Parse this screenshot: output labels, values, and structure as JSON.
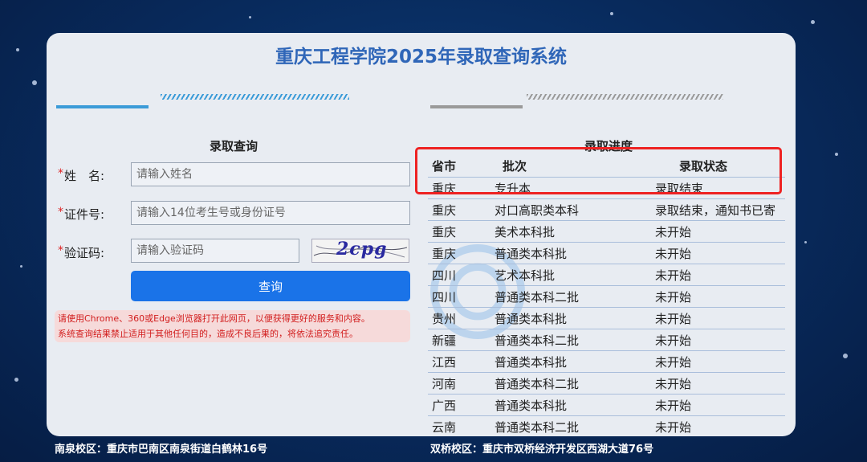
{
  "header": {
    "title": "重庆工程学院2025年录取查询系统"
  },
  "query_form": {
    "section_title": "录取查询",
    "name": {
      "label": "姓　名:",
      "placeholder": "请输入姓名"
    },
    "id_number": {
      "label": "证件号:",
      "placeholder": "请输入14位考生号或身份证号"
    },
    "captcha": {
      "label": "验证码:",
      "placeholder": "请输入验证码",
      "image_text": "2cpg"
    },
    "required_mark": "*",
    "submit_label": "查询",
    "notice_line1": "请使用Chrome、360或Edge浏览器打开此网页，以便获得更好的服务和内容。",
    "notice_line2": "系统查询结果禁止适用于其他任何目的，造成不良后果的，将依法追究责任。"
  },
  "progress": {
    "section_title": "录取进度",
    "columns": [
      "省市",
      "批次",
      "录取状态"
    ],
    "rows": [
      [
        "重庆",
        "专升本",
        "录取结束"
      ],
      [
        "重庆",
        "对口高职类本科",
        "录取结束，通知书已寄"
      ],
      [
        "重庆",
        "美术本科批",
        "未开始"
      ],
      [
        "重庆",
        "普通类本科批",
        "未开始"
      ],
      [
        "四川",
        "艺术本科批",
        "未开始"
      ],
      [
        "四川",
        "普通类本科二批",
        "未开始"
      ],
      [
        "贵州",
        "普通类本科批",
        "未开始"
      ],
      [
        "新疆",
        "普通类本科二批",
        "未开始"
      ],
      [
        "江西",
        "普通类本科批",
        "未开始"
      ],
      [
        "河南",
        "普通类本科二批",
        "未开始"
      ],
      [
        "广西",
        "普通类本科批",
        "未开始"
      ],
      [
        "云南",
        "普通类本科二批",
        "未开始"
      ]
    ]
  },
  "footer": {
    "campus_left": "南泉校区：重庆市巴南区南泉街道白鹤林16号",
    "campus_right": "双桥校区：重庆市双桥经济开发区西湖大道76号"
  },
  "colors": {
    "accent_blue": "#1a73e8",
    "title_blue": "#2f66b8",
    "highlight_red": "#ee2222",
    "notice_red": "#d21e1e"
  }
}
